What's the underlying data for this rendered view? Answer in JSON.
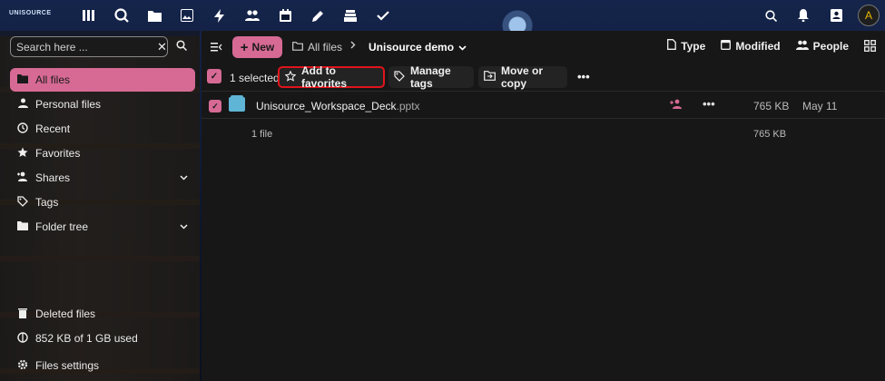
{
  "app": {
    "logo_text": "UNISOURCE",
    "icons": [
      "dashboard-icon",
      "search-circle-icon",
      "files-icon",
      "photos-icon",
      "activity-icon",
      "contacts-icon",
      "calendar-icon",
      "notes-icon",
      "deck-icon",
      "tasks-icon"
    ],
    "right_icons": [
      "search-icon",
      "notifications-icon",
      "contacts-menu-icon"
    ],
    "avatar_initial": "A"
  },
  "sidebar": {
    "search_placeholder": "Search here ...",
    "items": [
      {
        "label": "All files",
        "icon": "folder-icon",
        "active": true
      },
      {
        "label": "Personal files",
        "icon": "person-icon"
      },
      {
        "label": "Recent",
        "icon": "history-icon"
      },
      {
        "label": "Favorites",
        "icon": "star-icon"
      },
      {
        "label": "Shares",
        "icon": "share-icon",
        "expandable": true
      },
      {
        "label": "Tags",
        "icon": "tag-icon"
      },
      {
        "label": "Folder tree",
        "icon": "folder-tree-icon",
        "expandable": true
      }
    ],
    "deleted_files": "Deleted files",
    "storage": "852 KB of 1 GB used",
    "settings": "Files settings"
  },
  "breadcrumb": {
    "new_label": "New",
    "root": "All files",
    "current": "Unisource demo"
  },
  "view_tools": {
    "type": "Type",
    "modified": "Modified",
    "people": "People"
  },
  "actions": {
    "selected_text": "1 selected",
    "add_favorites": "Add to favorites",
    "manage_tags": "Manage tags",
    "move_copy": "Move or copy"
  },
  "files": [
    {
      "name": "Unisource_Workspace_Deck",
      "ext": ".pptx",
      "size": "765 KB",
      "date": "May 11"
    }
  ],
  "summary": {
    "count": "1 file",
    "size": "765 KB"
  },
  "colors": {
    "accent": "#d66a94",
    "highlight_border": "#e0141b"
  }
}
